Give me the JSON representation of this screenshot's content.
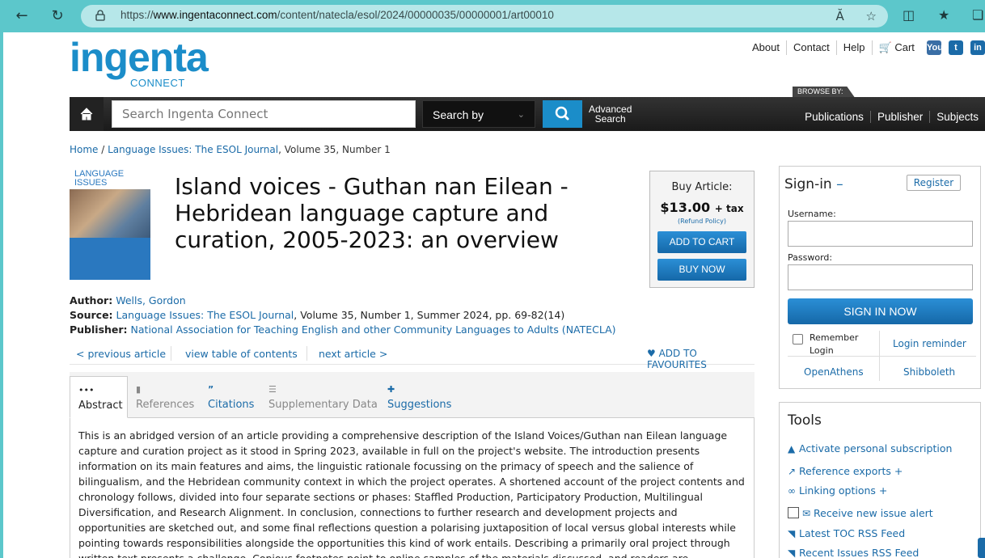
{
  "browser": {
    "url_prefix": "https://",
    "url_host": "www.ingentaconnect.com",
    "url_path": "/content/natecla/esol/2024/00000035/00000001/art00010",
    "read_aloud": "Ă"
  },
  "site": {
    "logo_main": "ingenta",
    "logo_sub": "CONNECT",
    "top_links": [
      "About",
      "Contact",
      "Help"
    ],
    "cart_label": "Cart",
    "social": [
      "You",
      "t",
      "in"
    ],
    "browse_by": "BROWSE BY:",
    "search_placeholder": "Search Ingenta Connect",
    "search_by": "Search by",
    "advanced_search_1": "Advanced",
    "advanced_search_2": "Search",
    "browse_links": [
      "Publications",
      "Publisher",
      "Subjects"
    ]
  },
  "breadcrumb": {
    "home": "Home",
    "sep": " / ",
    "journal": "Language Issues: The ESOL Journal",
    "rest": ", Volume 35, Number 1"
  },
  "cover": {
    "title_1": "LANGUAGE",
    "title_2": "ISSUES"
  },
  "article": {
    "title": "Island voices - Guthan nan Eilean - Hebridean language capture and curation, 2005-2023: an overview",
    "author_label": "Author:",
    "author": "Wells, Gordon",
    "source_label": "Source:",
    "source_journal": "Language Issues: The ESOL Journal",
    "source_rest": ", Volume 35, Number 1, Summer 2024, pp. 69-82(14)",
    "publisher_label": "Publisher:",
    "publisher": "National Association for Teaching English and other Community Languages to Adults (NATECLA)"
  },
  "buy": {
    "label": "Buy Article:",
    "price": "$13.00",
    "tax": "+ tax",
    "refund": "(Refund Policy)",
    "add_to_cart": "ADD TO CART",
    "buy_now": "BUY NOW"
  },
  "article_nav": {
    "prev": "< previous article",
    "toc": "view table of contents",
    "next": "next article >",
    "fav": "ADD TO FAVOURITES"
  },
  "tabs": [
    {
      "label": "Abstract",
      "icon": "•••"
    },
    {
      "label": "References",
      "icon": "▮"
    },
    {
      "label": "Citations",
      "icon": "”"
    },
    {
      "label": "Supplementary Data",
      "icon": "☰"
    },
    {
      "label": "Suggestions",
      "icon": "✚"
    }
  ],
  "abstract": "This is an abridged version of an article providing a comprehensive description of the Island Voices/Guthan nan Eilean language capture and curation project as it stood in Spring 2023, available in full on the project's website. The introduction presents information on its main features and aims, the linguistic rationale focussing on the primacy of speech and the salience of bilingualism, and the Hebridean community context in which the project operates. A shortened account of the project contents and chronology follows, divided into four separate sections or phases: Staffled Production, Participatory Production, Multilingual Diversification, and Research Alignment. In conclusion, connections to further research and development projects and opportunities are sketched out, and some final reflections question a polarising juxtaposition of local versus global interests while pointing towards responsibilities alongside the opportunities this kind of work entails. Describing a primarily oral project through written text presents a challenge. Copious footnotes point to online samples of the materials discussed, and readers are encouraged to engage through the screen as well as the page in order to extract full",
  "signin": {
    "title": "Sign-in",
    "dash": "–",
    "register": "Register",
    "username_label": "Username:",
    "password_label": "Password:",
    "button": "SIGN IN NOW",
    "remember_1": "Remember",
    "remember_2": "Login",
    "login_reminder": "Login reminder",
    "openathens": "OpenAthens",
    "shibboleth": "Shibboleth"
  },
  "tools": {
    "title": "Tools",
    "items": [
      {
        "icon": "▲",
        "label": "Activate personal subscription"
      },
      {
        "icon": "↗",
        "label": "Reference exports +"
      },
      {
        "icon": "∞",
        "label": "Linking options +"
      },
      {
        "icon": "✉",
        "label": "Receive new issue alert"
      },
      {
        "icon": "◥",
        "label": "Latest TOC RSS Feed"
      },
      {
        "icon": "◥",
        "label": "Recent Issues RSS Feed"
      }
    ]
  },
  "colors": {
    "brand": "#1b8dc9",
    "link": "#1b6ba8",
    "browser": "#5cc7cb"
  }
}
